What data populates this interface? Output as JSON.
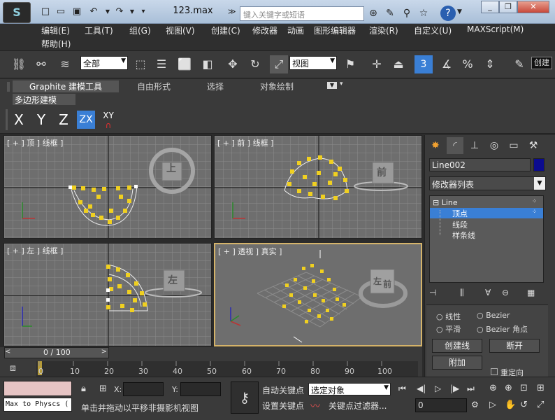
{
  "title_bar": {
    "document_title": "123.max",
    "search_placeholder": "键入关键字或短语",
    "quick_access_icons": [
      "new-file-icon",
      "open-folder-icon",
      "save-icon",
      "undo-icon",
      "redo-icon",
      "customize-dropdown-icon"
    ],
    "toolbar_icons": [
      "binoculars-icon",
      "wrench-icon",
      "star-icon",
      "help-icon"
    ],
    "window_buttons": [
      "minimize",
      "restore",
      "close"
    ]
  },
  "menu": [
    "编辑(E)",
    "工具(T)",
    "组(G)",
    "视图(V)",
    "创建(C)",
    "修改器",
    "动画",
    "图形编辑器",
    "渲染(R)",
    "自定义(U)",
    "MAXScript(M)",
    "帮助(H)"
  ],
  "main_toolbar": {
    "selection_filter": "全部",
    "reference_coord": "视图",
    "snap_label": "3",
    "named_set": "创建"
  },
  "ribbon": {
    "tabs": [
      "Graphite 建模工具",
      "自由形式",
      "选择",
      "对象绘制"
    ],
    "active_tab": 0,
    "sub_panel": "多边形建模",
    "axis_buttons": [
      "X",
      "Y",
      "Z",
      "ZX",
      "XY"
    ],
    "active_axis": "ZX"
  },
  "viewports": {
    "top": {
      "label": "[ + ] 顶 ] 线框 ]",
      "cube_face": "上"
    },
    "front": {
      "label": "[ + ] 前 ] 线框 ]",
      "cube_face": "前"
    },
    "left": {
      "label": "[ + ] 左 ] 线框 ]",
      "cube_face": "左"
    },
    "perspective": {
      "label": "[ + ] 透视 ] 真实 ]",
      "cube_faces": [
        "左",
        "前"
      ]
    }
  },
  "command_panel": {
    "object_name": "Line002",
    "object_color": "#0b0b8f",
    "modifier_list": "修改器列表",
    "stack": [
      {
        "label": "Line",
        "level": 0
      },
      {
        "label": "顶点",
        "level": 1,
        "selected": true
      },
      {
        "label": "线段",
        "level": 1
      },
      {
        "label": "样条线",
        "level": 1
      }
    ],
    "vertex_types": [
      "线性",
      "Bezier",
      "平滑",
      "Bezier 角点"
    ],
    "buttons": [
      "创建线",
      "断开",
      "附加"
    ],
    "checkbox_label": "重定向"
  },
  "timeline": {
    "frame_display": "0 / 100",
    "ticks": [
      "0",
      "10",
      "20",
      "30",
      "40",
      "50",
      "60",
      "70",
      "80",
      "90",
      "100"
    ]
  },
  "status_bar": {
    "maxscript_listener": "Max to Physcs (",
    "prompt": "单击并拖动以平移非摄影机视图",
    "x_label": "X:",
    "y_label": "Y:",
    "auto_key": "自动关键点",
    "set_key": "设置关键点",
    "key_mode": "选定对象",
    "key_filters": "关键点过滤器...",
    "current_frame": "0"
  },
  "colors": {
    "viewport_bg": "#6e6e6e",
    "grid_line": "#8a8a8a",
    "vertex": "#f0d020",
    "highlight": "#3a7fd5",
    "active_vp_border": "#d4b36a"
  }
}
